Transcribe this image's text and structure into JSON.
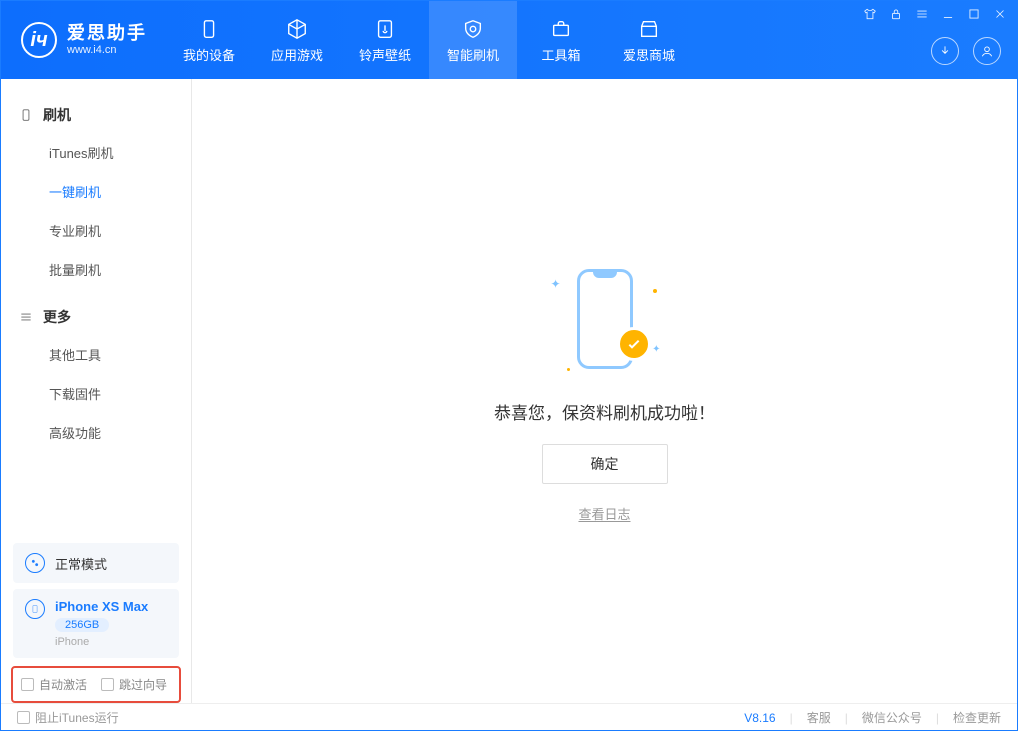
{
  "app": {
    "title": "爱思助手",
    "subtitle": "www.i4.cn"
  },
  "nav": [
    {
      "label": "我的设备"
    },
    {
      "label": "应用游戏"
    },
    {
      "label": "铃声壁纸"
    },
    {
      "label": "智能刷机"
    },
    {
      "label": "工具箱"
    },
    {
      "label": "爱思商城"
    }
  ],
  "sidebar": {
    "s1": {
      "title": "刷机",
      "items": [
        "iTunes刷机",
        "一键刷机",
        "专业刷机",
        "批量刷机"
      ]
    },
    "s2": {
      "title": "更多",
      "items": [
        "其他工具",
        "下载固件",
        "高级功能"
      ]
    }
  },
  "mode_label": "正常模式",
  "device": {
    "name": "iPhone XS Max",
    "capacity": "256GB",
    "type": "iPhone"
  },
  "bottom_checks": {
    "auto_activate": "自动激活",
    "skip_guide": "跳过向导"
  },
  "main": {
    "success": "恭喜您，保资料刷机成功啦！",
    "ok": "确定",
    "view_log": "查看日志"
  },
  "footer": {
    "block_itunes": "阻止iTunes运行",
    "version": "V8.16",
    "support": "客服",
    "wechat": "微信公众号",
    "update": "检查更新"
  }
}
